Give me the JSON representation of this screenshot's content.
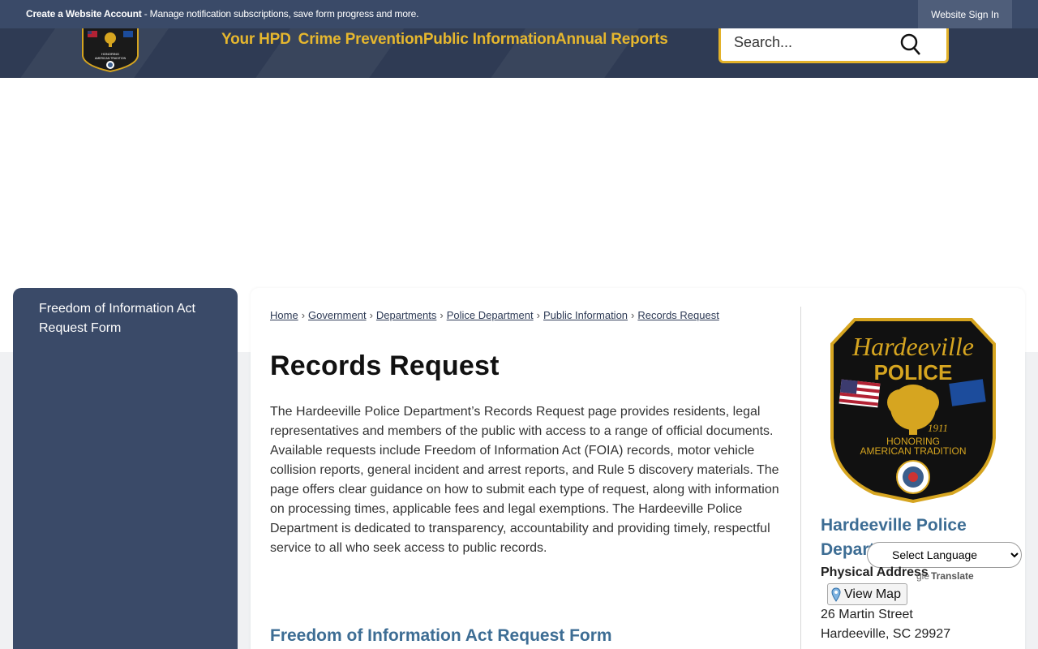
{
  "topbar": {
    "create_account": "Create a Website Account",
    "message": " - Manage notification subscriptions, save form progress and more.",
    "signin_label": "Website Sign In"
  },
  "nav": {
    "items": [
      "Your HPD",
      "Crime Prevention",
      "Public Information",
      "Annual Reports"
    ]
  },
  "search": {
    "placeholder": "Search..."
  },
  "sidebar": {
    "items": [
      {
        "label": "Freedom of Information Act Request Form"
      }
    ]
  },
  "breadcrumb": {
    "items": [
      "Home",
      "Government",
      "Departments",
      "Police Department",
      "Public Information",
      "Records Request"
    ],
    "separator": "›"
  },
  "page": {
    "title": "Records Request",
    "intro": "The Hardeeville Police Department’s Records Request page provides residents, legal representatives and members of the public with access to a range of official documents. Available requests include Freedom of Information Act (FOIA) records, motor vehicle collision reports, general incident and arrest reports, and Rule 5 discovery materials. The page offers clear guidance on how to submit each type of request, along with information on processing times, applicable fees and legal exemptions. The Hardeeville Police Department is dedicated to transparency, accountability and providing timely, respectful service to all who seek access to public records.",
    "section_link": "Freedom of Information Act Request Form"
  },
  "contact": {
    "badge": {
      "line1": "Hardeeville",
      "line2": "POLICE",
      "year": "1911",
      "motto1": "HONORING",
      "motto2": "AMERICAN TRADITION"
    },
    "dept_name": "Hardeeville Police Depart",
    "address_label": "Physical Address",
    "view_map": "View Map",
    "street": "26 Martin Street",
    "city": "Hardeeville, SC 29927"
  },
  "translate": {
    "select_label": "Select Language",
    "google": "gle",
    "translate": "Translate"
  },
  "colors": {
    "navy": "#3a4a68",
    "header": "#2f3b54",
    "gold": "#e6b72e",
    "link_blue": "#3d6d94"
  }
}
